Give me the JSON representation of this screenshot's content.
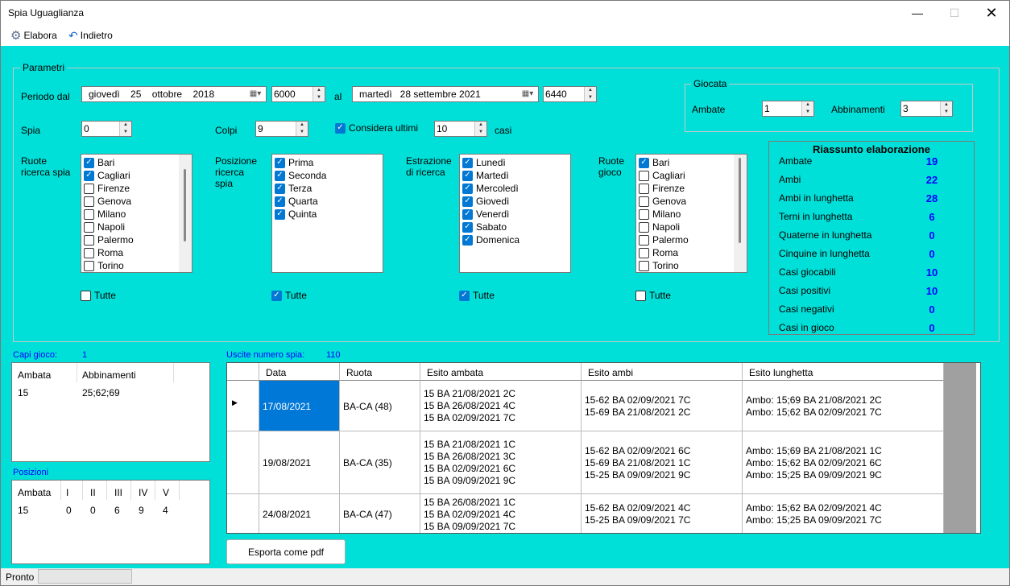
{
  "window": {
    "title": "Spia Uguaglianza"
  },
  "toolbar": {
    "elabora": "Elabora",
    "indietro": "Indietro"
  },
  "params": {
    "group_label": "Parametri",
    "periodo_dal_label": "Periodo dal",
    "date_from": {
      "weekday": "giovedì",
      "day": "25",
      "month": "ottobre",
      "year": "2018"
    },
    "date_from_num": "6000",
    "al_label": "al",
    "date_to": "martedì   28 settembre 2021",
    "date_to_num": "6440",
    "spia_label": "Spia",
    "spia_value": "0",
    "colpi_label": "Colpi",
    "colpi_value": "9",
    "considera_label": "Considera ultimi",
    "considera_value": "10",
    "casi_label": "casi",
    "giocata": {
      "label": "Giocata",
      "ambate_label": "Ambate",
      "ambate_value": "1",
      "abbinamenti_label": "Abbinamenti",
      "abbinamenti_value": "3"
    },
    "ruote_ricerca_label": "Ruote\nricerca spia",
    "posizione_label": "Posizione\nricerca\nspia",
    "estrazione_label": "Estrazione\ndi ricerca",
    "ruote_gioco_label": "Ruote\ngioco",
    "tutte_label": "Tutte",
    "ruote_ricerca": [
      {
        "label": "Bari",
        "checked": true
      },
      {
        "label": "Cagliari",
        "checked": true
      },
      {
        "label": "Firenze",
        "checked": false
      },
      {
        "label": "Genova",
        "checked": false
      },
      {
        "label": "Milano",
        "checked": false
      },
      {
        "label": "Napoli",
        "checked": false
      },
      {
        "label": "Palermo",
        "checked": false
      },
      {
        "label": "Roma",
        "checked": false
      },
      {
        "label": "Torino",
        "checked": false
      }
    ],
    "posizioni": [
      {
        "label": "Prima",
        "checked": true
      },
      {
        "label": "Seconda",
        "checked": true
      },
      {
        "label": "Terza",
        "checked": true
      },
      {
        "label": "Quarta",
        "checked": true
      },
      {
        "label": "Quinta",
        "checked": true
      }
    ],
    "estrazioni": [
      {
        "label": "Lunedì",
        "checked": true
      },
      {
        "label": "Martedì",
        "checked": true
      },
      {
        "label": "Mercoledì",
        "checked": true
      },
      {
        "label": "Giovedì",
        "checked": true
      },
      {
        "label": "Venerdì",
        "checked": true
      },
      {
        "label": "Sabato",
        "checked": true
      },
      {
        "label": "Domenica",
        "checked": true
      }
    ],
    "ruote_gioco": [
      {
        "label": "Bari",
        "checked": true
      },
      {
        "label": "Cagliari",
        "checked": false
      },
      {
        "label": "Firenze",
        "checked": false
      },
      {
        "label": "Genova",
        "checked": false
      },
      {
        "label": "Milano",
        "checked": false
      },
      {
        "label": "Napoli",
        "checked": false
      },
      {
        "label": "Palermo",
        "checked": false
      },
      {
        "label": "Roma",
        "checked": false
      },
      {
        "label": "Torino",
        "checked": false
      }
    ],
    "tutte_checked": [
      false,
      true,
      true,
      false
    ]
  },
  "summary": {
    "title": "Riassunto elaborazione",
    "rows": [
      {
        "k": "Ambate",
        "v": "19"
      },
      {
        "k": "Ambi",
        "v": "22"
      },
      {
        "k": "Ambi in lunghetta",
        "v": "28"
      },
      {
        "k": "Terni in lunghetta",
        "v": "6"
      },
      {
        "k": "Quaterne in lunghetta",
        "v": "0"
      },
      {
        "k": "Cinquine in lunghetta",
        "v": "0"
      },
      {
        "k": "Casi giocabili",
        "v": "10"
      },
      {
        "k": "Casi positivi",
        "v": "10"
      },
      {
        "k": "Casi negativi",
        "v": "0"
      },
      {
        "k": "Casi in gioco",
        "v": "0"
      }
    ]
  },
  "capi": {
    "label": "Capi gioco:",
    "count": "1",
    "headers": [
      "Ambata",
      "Abbinamenti"
    ],
    "row": [
      "15",
      "25;62;69"
    ]
  },
  "posizioni_panel": {
    "label": "Posizioni",
    "headers": [
      "Ambata",
      "I",
      "II",
      "III",
      "IV",
      "V"
    ],
    "row": [
      "15",
      "0",
      "0",
      "6",
      "9",
      "4"
    ]
  },
  "uscite": {
    "label": "Uscite numero spia:",
    "count": "110"
  },
  "grid": {
    "headers": [
      "Data",
      "Ruota",
      "Esito ambata",
      "Esito ambi",
      "Esito lunghetta"
    ],
    "rows": [
      {
        "data": "17/08/2021",
        "ruota": "BA-CA (48)",
        "ambata": [
          "15 BA  21/08/2021  2C",
          "15 BA  26/08/2021  4C",
          "15 BA  02/09/2021  7C"
        ],
        "ambi": [
          "15-62 BA  02/09/2021  7C",
          "15-69 BA  21/08/2021  2C"
        ],
        "lunghetta": [
          "Ambo: 15;69 BA  21/08/2021  2C",
          "Ambo: 15;62 BA  02/09/2021  7C"
        ]
      },
      {
        "data": "19/08/2021",
        "ruota": "BA-CA (35)",
        "ambata": [
          "15 BA  21/08/2021  1C",
          "15 BA  26/08/2021  3C",
          "15 BA  02/09/2021  6C",
          "15 BA  09/09/2021  9C"
        ],
        "ambi": [
          "15-62 BA  02/09/2021  6C",
          "15-69 BA  21/08/2021  1C",
          "15-25 BA  09/09/2021  9C"
        ],
        "lunghetta": [
          "Ambo: 15;69 BA  21/08/2021  1C",
          "Ambo: 15;62 BA  02/09/2021  6C",
          "Ambo: 15;25 BA  09/09/2021  9C"
        ]
      },
      {
        "data": "24/08/2021",
        "ruota": "BA-CA (47)",
        "ambata": [
          "15 BA  26/08/2021  1C",
          "15 BA  02/09/2021  4C",
          "15 BA  09/09/2021  7C"
        ],
        "ambi": [
          "15-62 BA  02/09/2021  4C",
          "15-25 BA  09/09/2021  7C"
        ],
        "lunghetta": [
          "Ambo: 15;62 BA  02/09/2021  4C",
          "Ambo: 15;25 BA  09/09/2021  7C"
        ]
      }
    ]
  },
  "export_button": "Esporta come pdf",
  "status": {
    "text": "Pronto"
  }
}
